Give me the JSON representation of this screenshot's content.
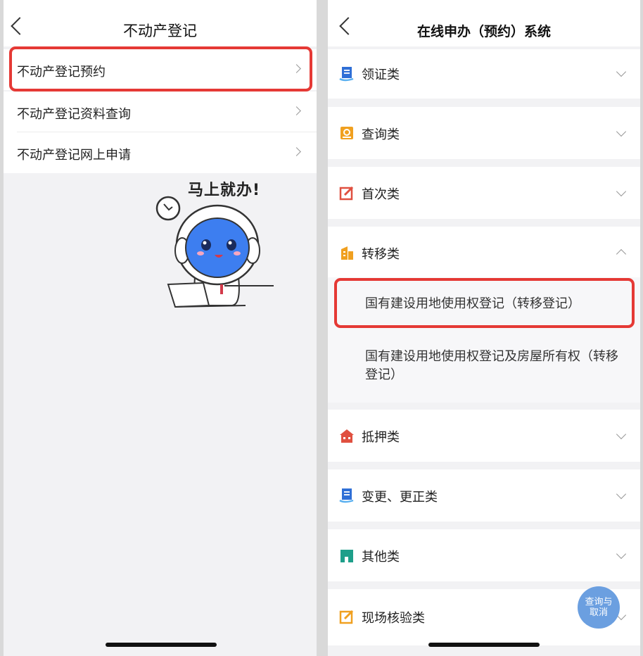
{
  "left": {
    "title": "不动产登记",
    "items": [
      {
        "label": "不动产登记预约"
      },
      {
        "label": "不动产登记资料查询"
      },
      {
        "label": "不动产登记网上申请"
      }
    ],
    "mascot_text": "马上就办!"
  },
  "right": {
    "title": "在线申办（预约）系统",
    "sections": [
      {
        "label": "领证类",
        "icon": "certificate-icon",
        "color": "#2f6fd6"
      },
      {
        "label": "查询类",
        "icon": "search-doc-icon",
        "color": "#f0a020"
      },
      {
        "label": "首次类",
        "icon": "edit-icon",
        "color": "#e05040"
      },
      {
        "label": "转移类",
        "icon": "building-icon",
        "color": "#f0a020",
        "expanded": true,
        "items": [
          "国有建设用地使用权登记（转移登记）",
          "国有建设用地使用权登记及房屋所有权（转移登记）"
        ]
      },
      {
        "label": "抵押类",
        "icon": "house-icon",
        "color": "#e05040"
      },
      {
        "label": "变更、更正类",
        "icon": "certificate-icon",
        "color": "#2f6fd6"
      },
      {
        "label": "其他类",
        "icon": "shop-icon",
        "color": "#1e9f8a"
      },
      {
        "label": "现场核验类",
        "icon": "edit-icon",
        "color": "#f0a020"
      }
    ],
    "fab": {
      "line1": "查询与",
      "line2": "取消"
    }
  },
  "colors": {
    "highlight": "#e53935",
    "fab": "#6b9fe0"
  }
}
